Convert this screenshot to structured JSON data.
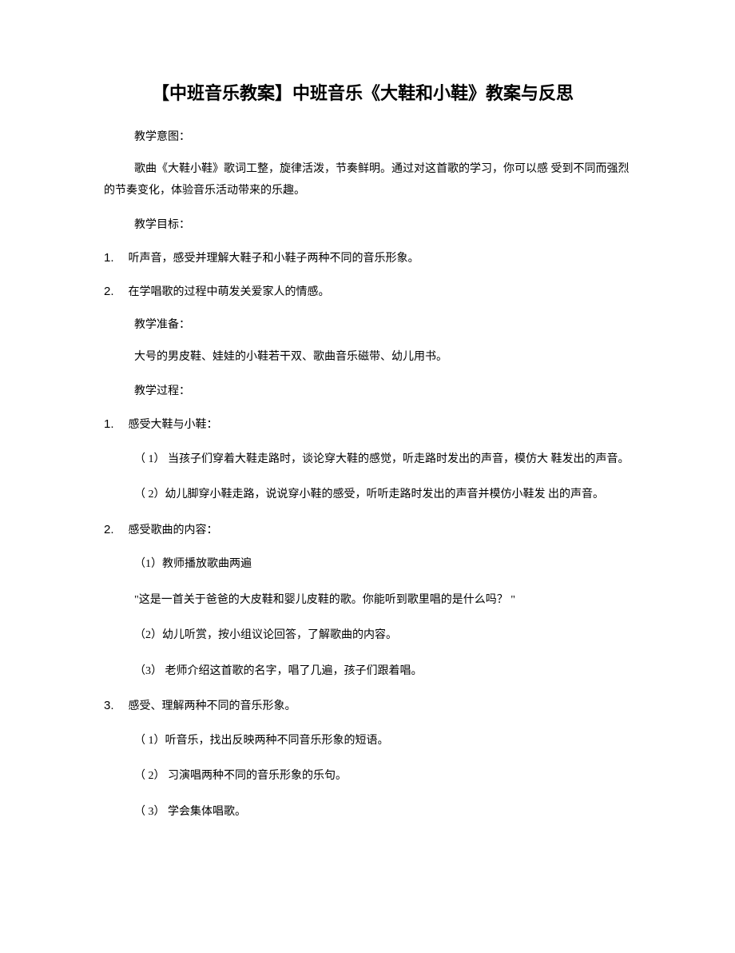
{
  "title": "【中班音乐教案】中班音乐《大鞋和小鞋》教案与反思",
  "section1_label": "教学意图：",
  "section1_body": "歌曲《大鞋小鞋》歌词工整，旋律活泼，节奏鲜明。通过对这首歌的学习，你可以感 受到不同而强烈的节奏变化，体验音乐活动带来的乐趣。",
  "section2_label": "教学目标：",
  "goals": [
    {
      "num": "1.",
      "text": "听声音，感受并理解大鞋子和小鞋子两种不同的音乐形象。"
    },
    {
      "num": "2.",
      "text": "在学唱歌的过程中萌发关爱家人的情感。"
    }
  ],
  "section3_label": "教学准备：",
  "section3_body": "大号的男皮鞋、娃娃的小鞋若干双、歌曲音乐磁带、幼儿用书。",
  "section4_label": "教学过程：",
  "process": {
    "item1": {
      "num": "1.",
      "text": "感受大鞋与小鞋："
    },
    "item1_sub1": "（ 1） 当孩子们穿着大鞋走路时，谈论穿大鞋的感觉，听走路时发出的声音，模仿大 鞋发出的声音。",
    "item1_sub2": "（ 2）幼儿脚穿小鞋走路，说说穿小鞋的感受，听听走路时发出的声音并模仿小鞋发 出的声音。",
    "item2": {
      "num": "2.",
      "text": "感受歌曲的内容："
    },
    "item2_sub1": "（1）教师播放歌曲两遍",
    "item2_quote": "\"这是一首关于爸爸的大皮鞋和婴儿皮鞋的歌。你能听到歌里唱的是什么吗？ \"",
    "item2_sub2": "（2）幼儿听赏，按小组议论回答，了解歌曲的内容。",
    "item2_sub3": "（3） 老师介绍这首歌的名字，唱了几遍，孩子们跟着唱。",
    "item3": {
      "num": "3.",
      "text": "感受、理解两种不同的音乐形象。"
    },
    "item3_sub1": "（ 1）听音乐，找出反映两种不同音乐形象的短语。",
    "item3_sub2": "（ 2） 习演唱两种不同的音乐形象的乐句。",
    "item3_sub3": "（ 3） 学会集体唱歌。"
  }
}
